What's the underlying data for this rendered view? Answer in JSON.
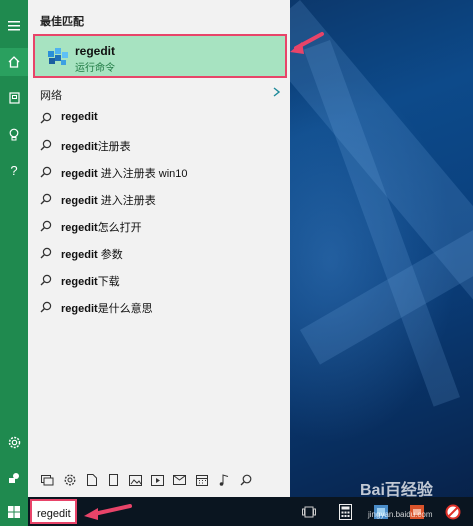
{
  "start_panel": {
    "best_match_header": "最佳匹配",
    "best_match": {
      "title": "regedit",
      "subtitle": "运行命令"
    },
    "network_label": "网络",
    "suggestions": [
      {
        "bold": "regedit",
        "rest": ""
      },
      {
        "bold": "regedit",
        "rest": "注册表"
      },
      {
        "bold": "regedit",
        "rest": " 进入注册表 win10"
      },
      {
        "bold": "regedit",
        "rest": " 进入注册表"
      },
      {
        "bold": "regedit",
        "rest": "怎么打开"
      },
      {
        "bold": "regedit",
        "rest": " 参数"
      },
      {
        "bold": "regedit",
        "rest": "下载"
      },
      {
        "bold": "regedit",
        "rest": "是什么意思"
      }
    ]
  },
  "rail": {
    "items": [
      "menu-icon",
      "home-icon",
      "notebook-icon",
      "lightbulb-icon",
      "help-icon",
      "settings-icon",
      "feedback-icon"
    ]
  },
  "filter_toolbar": {
    "items": [
      "apps-icon",
      "settings-icon",
      "document-icon",
      "folder-icon",
      "photo-icon",
      "video-icon",
      "email-icon",
      "calendar-icon",
      "music-icon",
      "search-icon"
    ]
  },
  "taskbar": {
    "search_value": "regedit",
    "items": [
      "task-view-icon",
      "calculator-icon",
      "app-icon",
      "app-icon-2",
      "app-icon-3"
    ]
  },
  "watermark": {
    "text": "Bai百经验",
    "sub": "jingyan.baidu.com"
  },
  "colors": {
    "accent_green": "#1f8a4f",
    "highlight_green": "#a7e3c1",
    "annotation_pink": "#e84469",
    "panel_bg": "#f2f2f2"
  }
}
